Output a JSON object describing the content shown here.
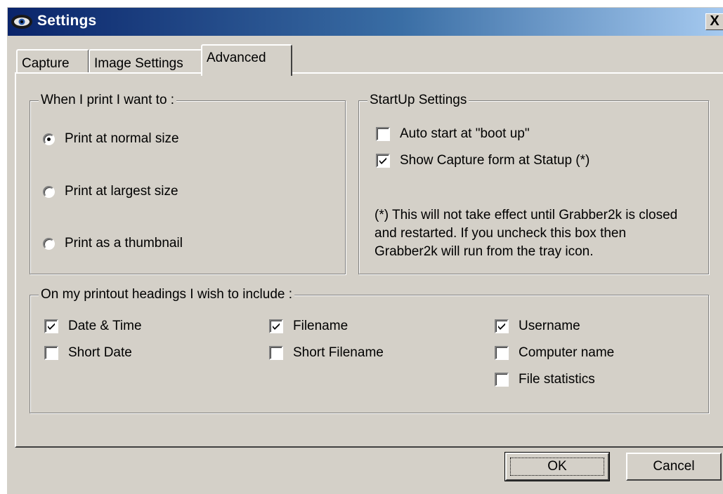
{
  "window": {
    "title": "Settings",
    "close_label": "X"
  },
  "tabs": [
    {
      "label": "Capture",
      "active": false
    },
    {
      "label": "Image Settings",
      "active": false
    },
    {
      "label": "Advanced",
      "active": true
    }
  ],
  "print_group": {
    "label": "When I print I want to :",
    "options": [
      {
        "label": "Print at normal size",
        "selected": true
      },
      {
        "label": "Print at largest size",
        "selected": false
      },
      {
        "label": "Print as a thumbnail",
        "selected": false
      }
    ]
  },
  "startup_group": {
    "label": "StartUp Settings",
    "options": [
      {
        "label": "Auto start at \"boot up\"",
        "checked": false
      },
      {
        "label": "Show Capture form at Statup (*)",
        "checked": true
      }
    ],
    "note": "(*)  This will not take effect until Grabber2k is closed and restarted. If you uncheck this box then Grabber2k will run from the tray icon."
  },
  "headings_group": {
    "label": "On my printout headings I wish to include :",
    "options": [
      {
        "label": "Date & Time",
        "checked": true
      },
      {
        "label": "Short Date",
        "checked": false
      },
      {
        "label": "Filename",
        "checked": true
      },
      {
        "label": "Short Filename",
        "checked": false
      },
      {
        "label": "Username",
        "checked": true
      },
      {
        "label": "Computer name",
        "checked": false
      },
      {
        "label": "File statistics",
        "checked": false
      }
    ]
  },
  "buttons": {
    "ok_label": "OK",
    "cancel_label": "Cancel"
  }
}
